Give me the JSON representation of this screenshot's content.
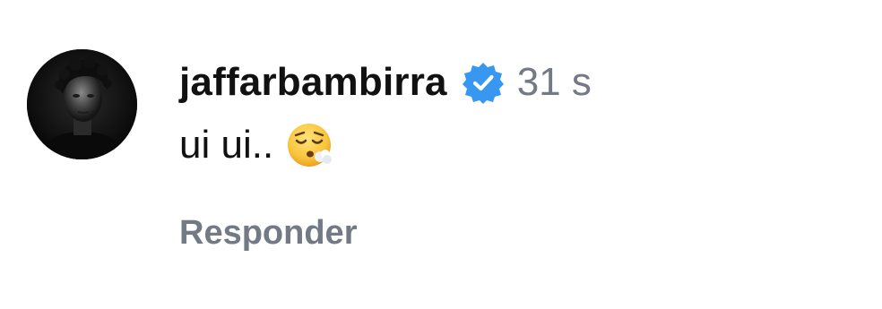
{
  "comment": {
    "username": "jaffarbambirra",
    "verified_icon": "verified-badge-icon",
    "timestamp": "31 s",
    "text": "ui ui..",
    "emoji": "face-exhaling-emoji",
    "reply_label": "Responder",
    "colors": {
      "username": "#111111",
      "meta": "#737a85",
      "verified": "#3897f0"
    }
  }
}
